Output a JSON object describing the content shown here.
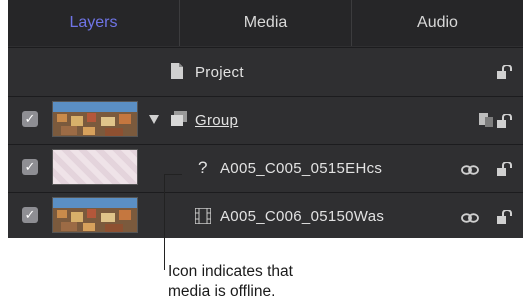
{
  "tabs": [
    {
      "label": "Layers",
      "active": true
    },
    {
      "label": "Media",
      "active": false
    },
    {
      "label": "Audio",
      "active": false
    }
  ],
  "layers": {
    "project_label": "Project",
    "rows": [
      {
        "label": "Group",
        "checked": true,
        "type": "group"
      },
      {
        "label": "A005_C005_0515EHcs",
        "checked": true,
        "type": "offline-clip",
        "status_glyph": "?"
      },
      {
        "label": "A005_C006_05150Was",
        "checked": true,
        "type": "clip"
      }
    ]
  },
  "callout": {
    "line1": "Icon indicates that",
    "line2": "media is offline."
  },
  "colors": {
    "panel_bg": "#2f2f31",
    "tab_active": "#6f74e6",
    "text": "#e2e2e2"
  }
}
